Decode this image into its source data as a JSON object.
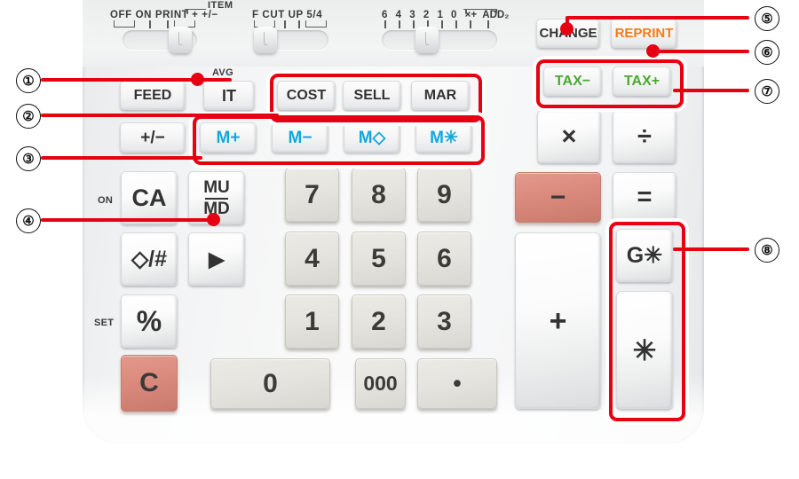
{
  "device": {
    "name": "printing-calculator-keypad",
    "accent_red": "#e60012",
    "key_cyan": "#13a8dc",
    "key_green": "#4aa832",
    "key_orange": "#ef7d1a",
    "key_red_fill": "#da8a7c"
  },
  "switches": [
    {
      "name": "print-mode-switch",
      "labels": [
        "OFF",
        "ON",
        "PRINT",
        "+",
        "+/−"
      ],
      "item_label": "ITEM"
    },
    {
      "name": "rounding-switch",
      "labels": [
        "F",
        "CUT",
        "UP",
        "5/4"
      ]
    },
    {
      "name": "decimal-switch",
      "labels": [
        "6",
        "4",
        "3",
        "2",
        "1",
        "0",
        "×+",
        "ADD₂"
      ]
    }
  ],
  "keys": {
    "feed": "FEED",
    "it": "IT",
    "it_sub": "AVG",
    "cost": "COST",
    "sell": "SELL",
    "mar": "MAR",
    "plusminus": "+/−",
    "mem_plus": "M+",
    "mem_minus": "M−",
    "mem_diamond": "M◇",
    "mem_star": "M✳",
    "ca": "CA",
    "ca_sub": "ON",
    "mu": "MU",
    "md": "MD",
    "diamond_hash": "◇/#",
    "arrow": "▶",
    "percent": "%",
    "percent_sub": "SET",
    "clear": "C",
    "multiply": "×",
    "divide": "÷",
    "minus": "−",
    "equals": "=",
    "plus": "+",
    "change": "CHANGE",
    "reprint": "REPRINT",
    "tax_minus": "TAX−",
    "tax_plus": "TAX+",
    "grand_star": "G✳",
    "star": "✳",
    "zero": "0",
    "triple_zero": "000",
    "point": "•",
    "digits": [
      "7",
      "8",
      "9",
      "4",
      "5",
      "6",
      "1",
      "2",
      "3"
    ]
  },
  "callouts": [
    {
      "id": "1",
      "label": "①",
      "target": "it-key"
    },
    {
      "id": "2",
      "label": "②",
      "target": "cost-sell-mar-group"
    },
    {
      "id": "3",
      "label": "③",
      "target": "memory-key-group"
    },
    {
      "id": "4",
      "label": "④",
      "target": "mu-md-key"
    },
    {
      "id": "5",
      "label": "⑤",
      "target": "change-key"
    },
    {
      "id": "6",
      "label": "⑥",
      "target": "reprint-key"
    },
    {
      "id": "7",
      "label": "⑦",
      "target": "tax-key-group"
    },
    {
      "id": "8",
      "label": "⑧",
      "target": "grand-total-key-group"
    }
  ]
}
